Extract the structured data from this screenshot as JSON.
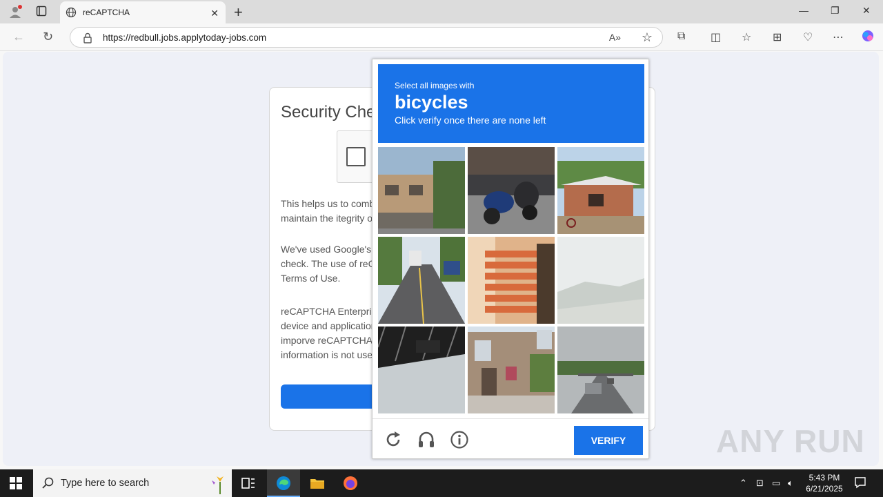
{
  "browser": {
    "tab_title": "reCAPTCHA",
    "url": "https://redbull.jobs.applytoday-jobs.com"
  },
  "card": {
    "title": "Security Chec",
    "para1": [
      "This helps us to comba",
      "maintain the itegrity of"
    ],
    "para2": [
      "We've used Google's r",
      "check. The use of reC",
      "Terms of Use."
    ],
    "para3": [
      "reCAPTCHA Enterpris",
      "device and application",
      "imporve reCAPTCHA",
      "information is not used"
    ]
  },
  "challenge": {
    "instruction_small": "Select all images with",
    "target": "bicycles",
    "instruction_sub": "Click verify once there are none left",
    "verify_label": "VERIFY"
  },
  "watermark": "ANY RUN",
  "taskbar": {
    "search_placeholder": "Type here to search",
    "time": "5:43 PM",
    "date": "6/21/2025"
  },
  "colors": {
    "accent": "#1a73e8",
    "taskbar": "#1c1c1c"
  }
}
